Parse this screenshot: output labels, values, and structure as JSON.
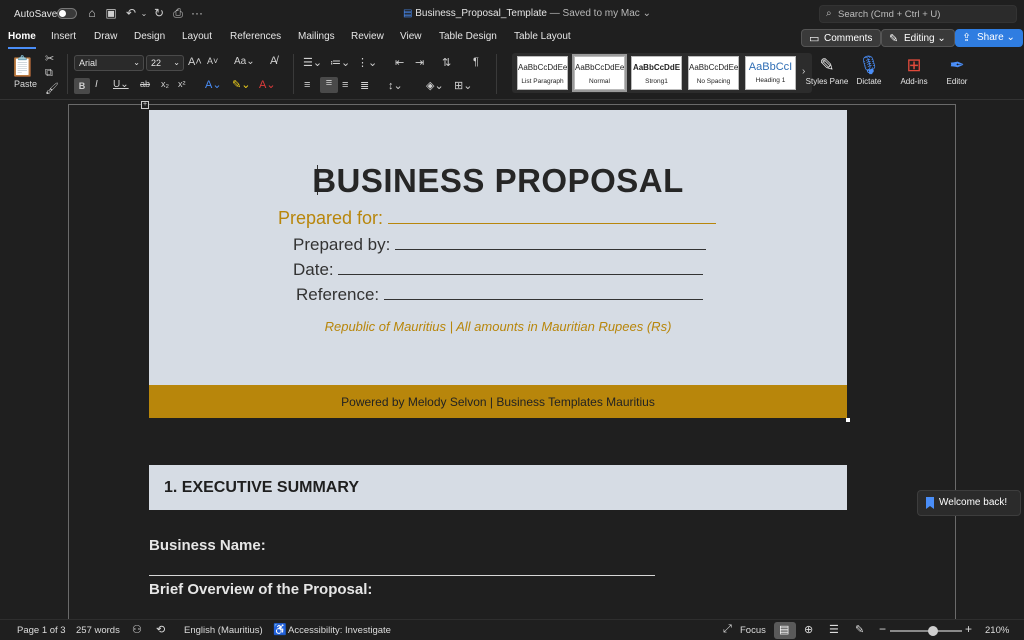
{
  "titlebar": {
    "autosave": "AutoSave",
    "doc_name": "Business_Proposal_Template",
    "saved_status": " — Saved to my Mac",
    "search_placeholder": "Search (Cmd + Ctrl + U)"
  },
  "tabs": [
    "Home",
    "Insert",
    "Draw",
    "Design",
    "Layout",
    "References",
    "Mailings",
    "Review",
    "View",
    "Table Design",
    "Table Layout"
  ],
  "actions": {
    "comments": "Comments",
    "editing": "Editing",
    "share": "Share"
  },
  "ribbon": {
    "paste": "Paste",
    "font_name": "Arial",
    "font_size": "22",
    "styles": [
      {
        "sample": "AaBbCcDdEe",
        "name": "List Paragraph"
      },
      {
        "sample": "AaBbCcDdEe",
        "name": "Normal"
      },
      {
        "sample": "AaBbCcDdE",
        "name": "Strong1"
      },
      {
        "sample": "AaBbCcDdEe",
        "name": "No Spacing"
      },
      {
        "sample": "AaBbCcI",
        "name": "Heading 1"
      }
    ],
    "styles_pane": "Styles Pane",
    "dictate": "Dictate",
    "addins": "Add-ins",
    "editor": "Editor"
  },
  "document": {
    "title": "BUSINESS PROPOSAL",
    "prepared_for": "Prepared for:",
    "prepared_by": "Prepared by:",
    "date": "Date:",
    "reference": "Reference:",
    "note": "Republic of Mauritius  |  All amounts in Mauritian Rupees (Rs)",
    "footer": "Powered by Melody Selvon  |  Business Templates Mauritius",
    "section_1": "1.  EXECUTIVE SUMMARY",
    "business_name": "Business Name:",
    "brief_overview": "Brief Overview of the Proposal:"
  },
  "toast": "Welcome back!",
  "status": {
    "page": "Page 1 of 3",
    "words": "257 words",
    "language": "English (Mauritius)",
    "accessibility": "Accessibility: Investigate",
    "focus": "Focus",
    "zoom": "210%"
  },
  "colors": {
    "accent": "#b8860b",
    "cover_bg": "#d6dce4",
    "share_blue": "#2f7de1"
  }
}
